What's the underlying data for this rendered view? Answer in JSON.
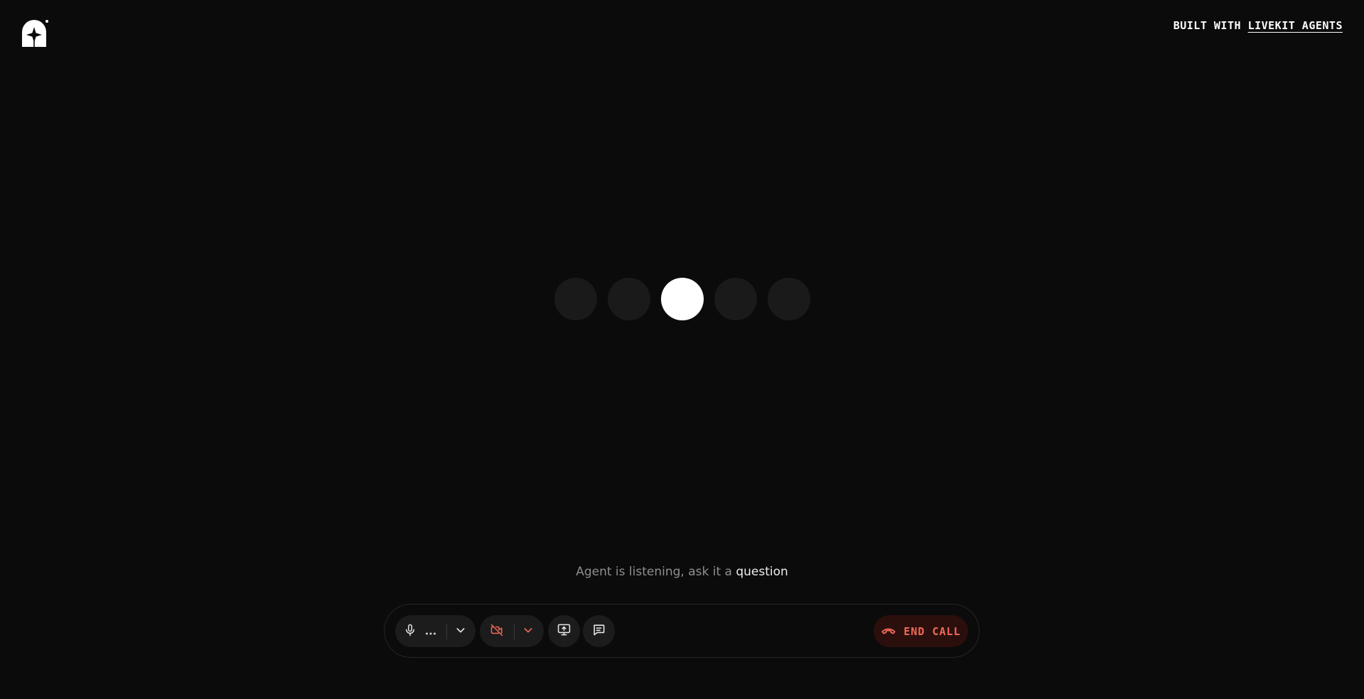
{
  "header": {
    "logo_icon": "livekit-agent-logo-icon",
    "built_with_prefix": "BUILT WITH",
    "built_with_link": "LIVEKIT AGENTS"
  },
  "visualizer": {
    "bar_count": 5,
    "active_index": 2
  },
  "status": {
    "text_dim": "Agent is listening, ask it a ",
    "text_bright": "question"
  },
  "controls": {
    "mic_icon": "microphone-icon",
    "mic_level_icon": "dots-icon",
    "mic_dropdown_icon": "chevron-down-icon",
    "camera_icon": "camera-off-icon",
    "camera_dropdown_icon": "chevron-down-icon",
    "share_icon": "screen-share-icon",
    "chat_icon": "chat-icon",
    "end_call_icon": "phone-hangup-icon",
    "end_call_label": "END CALL"
  },
  "colors": {
    "background": "#0b0b0b",
    "danger": "#f06a57",
    "danger_bg": "#2a0f0d",
    "dot_idle": "#1a1a1a",
    "dot_active": "#ffffff"
  }
}
